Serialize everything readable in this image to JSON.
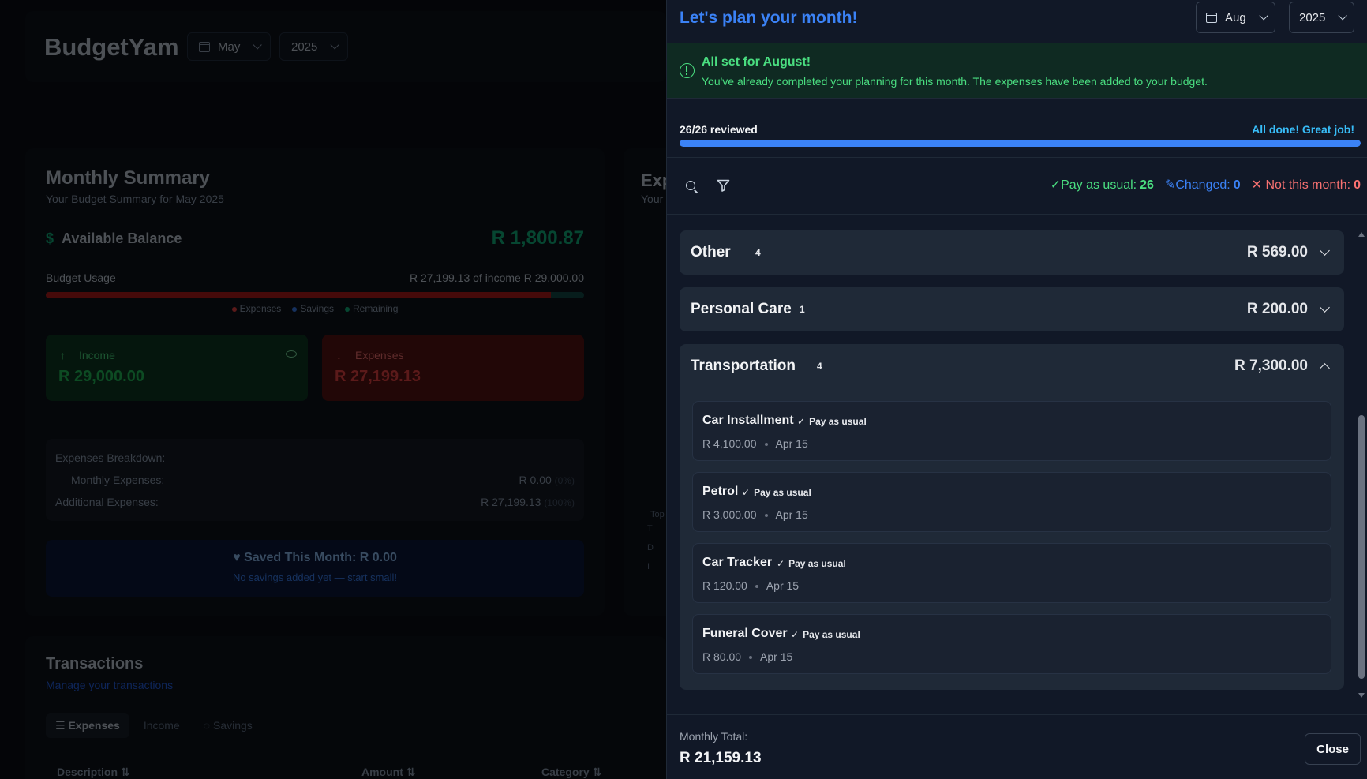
{
  "background": {
    "brand": "BudgetYam",
    "month": "May",
    "year": "2025",
    "summary": {
      "title": "Monthly Summary",
      "subtitle": "Your Budget Summary for May 2025",
      "available_label": "Available Balance",
      "available_value": "R 1,800.87",
      "usage_label": "Budget Usage",
      "usage_value": "R 27,199.13 of income R 29,000.00",
      "usage_fraction": 0.938,
      "legend": [
        "Expenses",
        "Savings",
        "Remaining"
      ],
      "income_label": "Income",
      "income_value": "R 29,000.00",
      "expenses_label": "Expenses",
      "expenses_value": "R 27,199.13",
      "breakdown_title": "Expenses Breakdown:",
      "monthly_label": "Monthly Expenses:",
      "monthly_value": "R 0.00",
      "monthly_pct": "(0%)",
      "additional_label": "Additional Expenses:",
      "additional_value": "R 27,199.13",
      "additional_pct": "(100%)",
      "saved_title": "Saved This Month: R 0.00",
      "saved_sub": "No savings added yet — start small!"
    },
    "side": {
      "title": "Exp",
      "subtitle": "Your",
      "mini": [
        "Top",
        "T",
        "D",
        "I"
      ]
    },
    "transactions": {
      "title": "Transactions",
      "subtitle": "Manage your transactions",
      "tabs": [
        "Expenses",
        "Income",
        "Savings"
      ],
      "columns": [
        "Description ⇅",
        "Amount ⇅",
        "Category ⇅"
      ]
    }
  },
  "drawer": {
    "title": "Let's plan your month!",
    "month": "Aug",
    "year": "2025",
    "alert_title": "All set for August!",
    "alert_text": "You've already completed your planning for this month. The expenses have been added to your budget.",
    "progress_label": "26/26 reviewed",
    "progress_done": "All done! Great job!",
    "progress_fraction": 1.0,
    "counts": {
      "usual_label": "Pay as usual:",
      "usual_count": "26",
      "changed_label": "Changed:",
      "changed_count": "0",
      "skip_label": "Not this month:",
      "skip_count": "0"
    },
    "categories": [
      {
        "name": "Other",
        "count": "4",
        "amount": "R 569.00"
      },
      {
        "name": "Personal Care",
        "count": "1",
        "amount": "R 200.00"
      }
    ],
    "open_category": {
      "name": "Transportation",
      "count": "4",
      "amount": "R 7,300.00",
      "items": [
        {
          "name": "Car Installment",
          "status": "Pay as usual",
          "amount": "R 4,100.00",
          "date": "Apr 15"
        },
        {
          "name": "Petrol",
          "status": "Pay as usual",
          "amount": "R 3,000.00",
          "date": "Apr 15"
        },
        {
          "name": "Car Tracker",
          "status": "Pay as usual",
          "amount": "R 120.00",
          "date": "Apr 15"
        },
        {
          "name": "Funeral Cover",
          "status": "Pay as usual",
          "amount": "R 80.00",
          "date": "Apr 15"
        }
      ]
    },
    "footer_label": "Monthly Total:",
    "footer_total": "R 21,159.13",
    "close_label": "Close"
  },
  "colors": {
    "accent": "#3b82f6",
    "success": "#4ade80",
    "danger": "#f87171",
    "panel": "#111827"
  }
}
